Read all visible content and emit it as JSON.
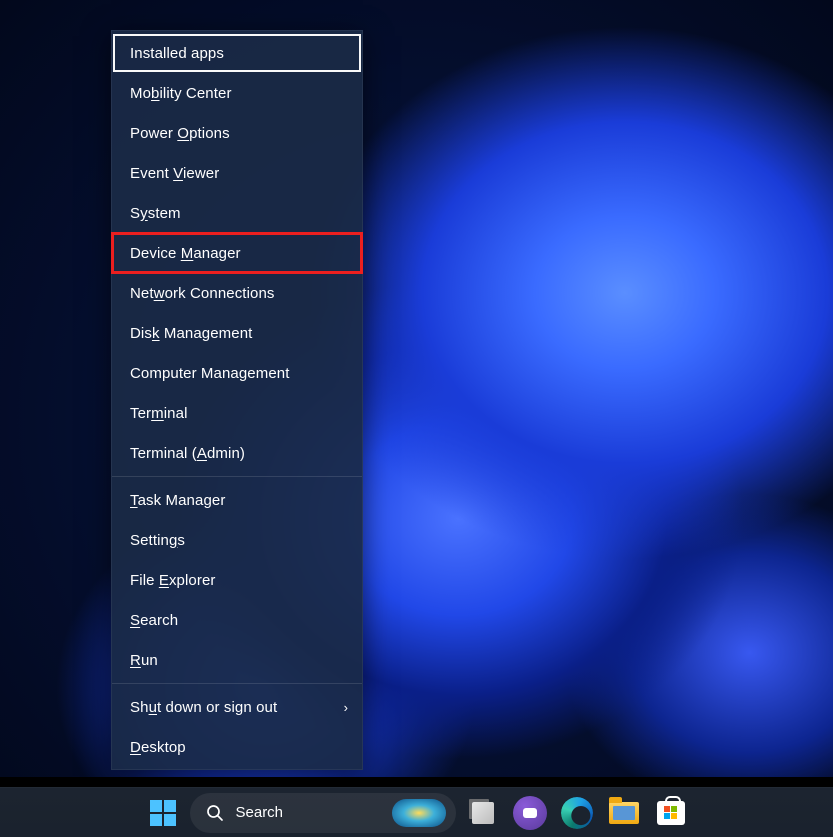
{
  "menu": {
    "groups": [
      [
        {
          "label": "Installed apps",
          "key": "installed-apps",
          "ul": null,
          "focused": true
        },
        {
          "label": "Mobility Center",
          "key": "mobility-center",
          "ul": [
            2,
            3
          ]
        },
        {
          "label": "Power Options",
          "key": "power-options",
          "ul": [
            6,
            7
          ]
        },
        {
          "label": "Event Viewer",
          "key": "event-viewer",
          "ul": [
            6,
            7
          ]
        },
        {
          "label": "System",
          "key": "system",
          "ul": [
            1,
            2
          ]
        },
        {
          "label": "Device Manager",
          "key": "device-manager",
          "ul": [
            7,
            8
          ],
          "highlighted": true
        },
        {
          "label": "Network Connections",
          "key": "network-connections",
          "ul": [
            3,
            4
          ]
        },
        {
          "label": "Disk Management",
          "key": "disk-management",
          "ul": [
            3,
            4
          ]
        },
        {
          "label": "Computer Management",
          "key": "computer-management",
          "ul": null
        },
        {
          "label": "Terminal",
          "key": "terminal",
          "ul": [
            3,
            4
          ]
        },
        {
          "label": "Terminal (Admin)",
          "key": "terminal-admin",
          "ul": [
            10,
            11
          ]
        }
      ],
      [
        {
          "label": "Task Manager",
          "key": "task-manager",
          "ul": [
            0,
            1
          ]
        },
        {
          "label": "Settings",
          "key": "settings",
          "ul": [
            6,
            7
          ]
        },
        {
          "label": "File Explorer",
          "key": "file-explorer",
          "ul": [
            5,
            6
          ]
        },
        {
          "label": "Search",
          "key": "search",
          "ul": [
            0,
            1
          ]
        },
        {
          "label": "Run",
          "key": "run",
          "ul": [
            0,
            1
          ]
        }
      ],
      [
        {
          "label": "Shut down or sign out",
          "key": "shut-down",
          "ul": [
            2,
            3
          ],
          "submenu": true
        },
        {
          "label": "Desktop",
          "key": "desktop",
          "ul": [
            0,
            1
          ]
        }
      ]
    ]
  },
  "taskbar": {
    "search_placeholder": "Search"
  }
}
